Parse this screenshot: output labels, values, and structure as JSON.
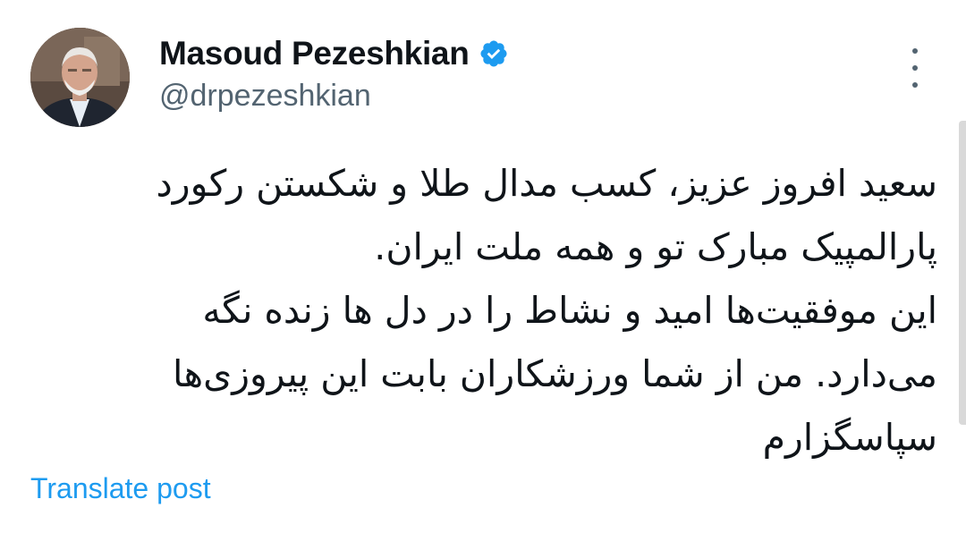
{
  "author": {
    "display_name": "Masoud Pezeshkian",
    "handle": "@drpezeshkian",
    "verified": true,
    "avatar_icon": "profile-photo"
  },
  "post": {
    "text_lines": [
      "سعید افروز عزیز، کسب مدال طلا و شکستن رکورد",
      "پارالمپیک مبارک تو و همه ملت ایران.",
      "این موفقیت‌ها امید و نشاط را در دل ها زنده نگه",
      "می‌دارد. من از شما ورزشکاران بابت این پیروزی‌ها",
      "سپاسگزارم"
    ]
  },
  "actions": {
    "translate_label": "Translate post",
    "more_icon": "more-vertical-icon",
    "verified_icon": "verified-badge-icon"
  },
  "colors": {
    "text_primary": "#0f1419",
    "text_secondary": "#536471",
    "link": "#1d9bf0",
    "verified": "#1d9bf0",
    "background": "#ffffff"
  }
}
